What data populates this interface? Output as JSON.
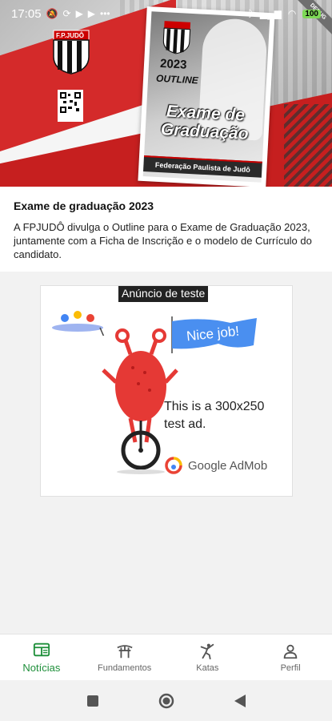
{
  "statusbar": {
    "time": "17:05",
    "battery": "100"
  },
  "hero": {
    "crest_text": "F.P.JUDÔ",
    "poster": {
      "year": "2023",
      "outline": "OUTLINE",
      "title_line1": "Exame de",
      "title_line2": "Graduação",
      "band": "Federação Paulista de Judô",
      "ribbon": "DEBUG"
    }
  },
  "article": {
    "title": "Exame de graduação 2023",
    "body": "A FPJUDÔ divulga o Outline para o Exame de Graduação 2023, juntamente com a Ficha de Inscrição e o modelo de Currículo do candidato."
  },
  "ad": {
    "label": "Anúncio de teste",
    "flag_text": "Nice job!",
    "text": "This is a 300x250 test ad.",
    "brand": "Google AdMob"
  },
  "bottomnav": {
    "items": [
      {
        "label": "Notícias",
        "icon": "news-icon",
        "active": true
      },
      {
        "label": "Fundamentos",
        "icon": "dojo-icon",
        "active": false
      },
      {
        "label": "Katas",
        "icon": "martial-arts-icon",
        "active": false
      },
      {
        "label": "Perfil",
        "icon": "person-icon",
        "active": false
      }
    ]
  },
  "colors": {
    "accent": "#1e8f3a",
    "hero_red": "#d42a2a"
  }
}
